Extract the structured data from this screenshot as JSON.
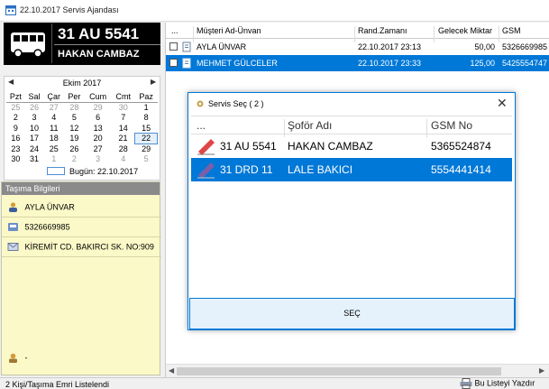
{
  "window": {
    "title": "22.10.2017 Servis Ajandası",
    "icon": "calendar-icon"
  },
  "vehicle": {
    "plate": "31 AU 5541",
    "driver": "HAKAN CAMBAZ",
    "icon": "bus-icon"
  },
  "calendar": {
    "month_label": "Ekim 2017",
    "prev": "◀",
    "next": "▶",
    "weekdays": [
      "Pzt",
      "Sal",
      "Çar",
      "Per",
      "Cum",
      "Cmt",
      "Paz"
    ],
    "weeks": [
      [
        "25",
        "26",
        "27",
        "28",
        "29",
        "30",
        "1"
      ],
      [
        "2",
        "3",
        "4",
        "5",
        "6",
        "7",
        "8"
      ],
      [
        "9",
        "10",
        "11",
        "12",
        "13",
        "14",
        "15"
      ],
      [
        "16",
        "17",
        "18",
        "19",
        "20",
        "21",
        "22"
      ],
      [
        "23",
        "24",
        "25",
        "26",
        "27",
        "28",
        "29"
      ],
      [
        "30",
        "31",
        "1",
        "2",
        "3",
        "4",
        "5"
      ]
    ],
    "today_label": "Bugün: 22.10.2017"
  },
  "tasima": {
    "header": "Taşıma Bilgileri",
    "name": "AYLA ÜNVAR",
    "phone": "5326669985",
    "address": "KİREMİT CD. BAKIRCI SK. NO:909",
    "note": "-"
  },
  "grid": {
    "columns": [
      "...",
      "Müşteri Ad-Ünvan",
      "Rand.Zamanı",
      "Gelecek Miktar",
      "GSM"
    ],
    "rows": [
      {
        "name": "AYLA ÜNVAR",
        "time": "22.10.2017 23:13",
        "amount": "50,00",
        "gsm": "5326669985",
        "selected": false
      },
      {
        "name": "MEHMET GÜLCELER",
        "time": "22.10.2017 23:33",
        "amount": "125,00",
        "gsm": "5425554747",
        "selected": true
      }
    ]
  },
  "dialog": {
    "title": "Servis Seç ( 2 )",
    "close": "✕",
    "columns": [
      "...",
      "Şoför Adı",
      "GSM No"
    ],
    "rows": [
      {
        "plate": "31 AU 5541",
        "driver": "HAKAN CAMBAZ",
        "gsm": "5365524874",
        "selected": false,
        "icon_color": "#e04646"
      },
      {
        "plate": "31 DRD 11",
        "driver": "LALE BAKICI",
        "gsm": "5554441414",
        "selected": true,
        "icon_color": "#7a5fa8"
      }
    ],
    "button": "SEÇ"
  },
  "status": {
    "text": "2 Kişi/Taşıma Emri Listelendi",
    "right": "Bu Listeyi Yazdır"
  },
  "colors": {
    "accent": "#0078d7",
    "note_bg": "#fbf9c7"
  }
}
